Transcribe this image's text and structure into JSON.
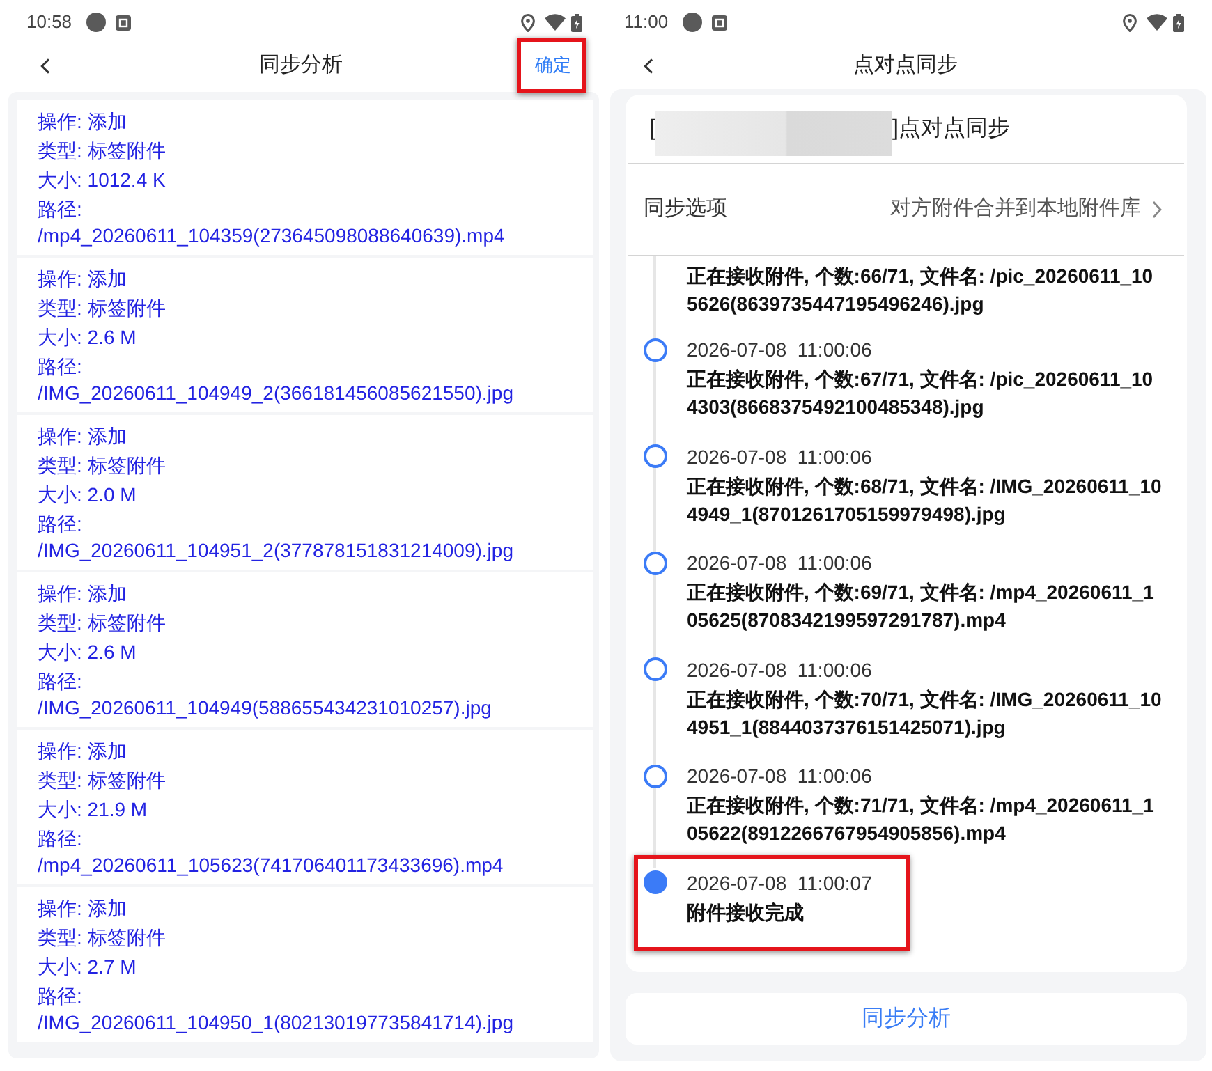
{
  "analysis_screen": {
    "status_bar": {
      "time": "10:58"
    },
    "header": {
      "title": "同步分析",
      "action": {
        "label": "确定",
        "annotated": true
      }
    },
    "entries": [
      {
        "operation": "操作: 添加",
        "type": "类型: 标签附件",
        "size": "大小: 1012.4 K",
        "path": "路径: /mp4_20260611_104359(273645098088640639).mp4"
      },
      {
        "operation": "操作: 添加",
        "type": "类型: 标签附件",
        "size": "大小: 2.6 M",
        "path": "路径: /IMG_20260611_104949_2(366181456085621550).jpg"
      },
      {
        "operation": "操作: 添加",
        "type": "类型: 标签附件",
        "size": "大小: 2.0 M",
        "path": "路径: /IMG_20260611_104951_2(377878151831214009).jpg"
      },
      {
        "operation": "操作: 添加",
        "type": "类型: 标签附件",
        "size": "大小: 2.6 M",
        "path": "路径: /IMG_20260611_104949(588655434231010257).jpg"
      },
      {
        "operation": "操作: 添加",
        "type": "类型: 标签附件",
        "size": "大小: 21.9 M",
        "path": "路径: /mp4_20260611_105623(741706401173433696).mp4"
      },
      {
        "operation": "操作: 添加",
        "type": "类型: 标签附件",
        "size": "大小: 2.7 M",
        "path": "路径: /IMG_20260611_104950_1(802130197735841714).jpg"
      }
    ]
  },
  "peer_sync_screen": {
    "status_bar": {
      "time": "11:00"
    },
    "header": {
      "title": "点对点同步"
    },
    "session": {
      "title_start": "[",
      "redacted": true,
      "title_end": "]点对点同步"
    },
    "sync_option": {
      "label": "同步选项",
      "value": "对方附件合并到本地附件库"
    },
    "timeline": {
      "clipped_entry": {
        "message": "正在接收附件, 个数:66/71, 文件名: /pic_20260611_105626(8639735447195496246).jpg"
      },
      "entries": [
        {
          "time": "2026-07-08  11:00:06",
          "message": "正在接收附件, 个数:67/71, 文件名: /pic_20260611_104303(8668375492100485348).jpg",
          "current": false,
          "annotated": false
        },
        {
          "time": "2026-07-08  11:00:06",
          "message": "正在接收附件, 个数:68/71, 文件名: /IMG_20260611_104949_1(8701261705159979498).jpg",
          "current": false,
          "annotated": false
        },
        {
          "time": "2026-07-08  11:00:06",
          "message": "正在接收附件, 个数:69/71, 文件名: /mp4_20260611_105625(8708342199597291787).mp4",
          "current": false,
          "annotated": false
        },
        {
          "time": "2026-07-08  11:00:06",
          "message": "正在接收附件, 个数:70/71, 文件名: /IMG_20260611_104951_1(8844037376151425071).jpg",
          "current": false,
          "annotated": false
        },
        {
          "time": "2026-07-08  11:00:06",
          "message": "正在接收附件, 个数:71/71, 文件名: /mp4_20260611_105622(8912266767954905856).mp4",
          "current": false,
          "annotated": false
        },
        {
          "time": "2026-07-08  11:00:07",
          "message": "附件接收完成",
          "current": true,
          "annotated": true
        }
      ]
    },
    "footer_button": {
      "label": "同步分析"
    }
  }
}
